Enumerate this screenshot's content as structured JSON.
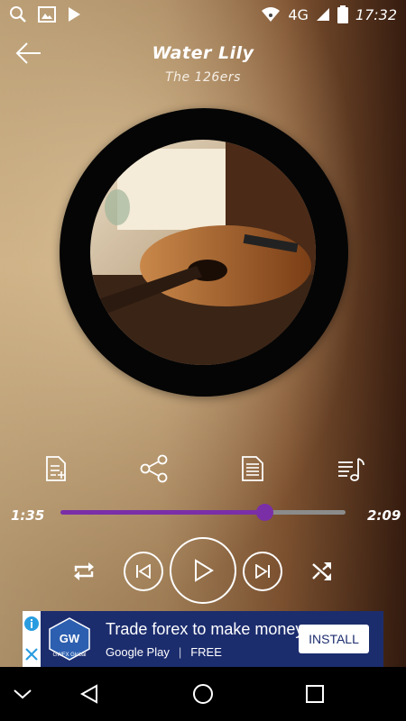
{
  "status_bar": {
    "network": "4G",
    "time": "17:32",
    "icons": [
      "search-icon",
      "image-icon",
      "play-store-icon",
      "wifi-icon",
      "signal-icon",
      "battery-icon"
    ]
  },
  "header": {
    "back_icon": "arrow-left-icon",
    "title": "Water Lily",
    "artist": "The 126ers"
  },
  "actions": [
    {
      "name": "add-to-playlist",
      "icon": "playlist-add-icon"
    },
    {
      "name": "share",
      "icon": "share-icon"
    },
    {
      "name": "lyrics",
      "icon": "document-icon"
    },
    {
      "name": "queue",
      "icon": "queue-music-icon"
    }
  ],
  "player": {
    "elapsed": "1:35",
    "duration": "2:09",
    "progress": 0.715,
    "accent_color": "#7a2fa7",
    "controls": [
      "repeat-icon",
      "previous-icon",
      "play-icon",
      "next-icon",
      "shuffle-icon"
    ]
  },
  "ad": {
    "logo_text": "GW",
    "logo_caption": "GWFX Global",
    "headline": "Trade forex to make money",
    "store": "Google Play",
    "price": "FREE",
    "cta": "INSTALL",
    "background_color": "#1c2d6e"
  },
  "nav_bar": {
    "icons": [
      "chevron-down-icon",
      "back-triangle-icon",
      "home-circle-icon",
      "recents-square-icon"
    ]
  }
}
